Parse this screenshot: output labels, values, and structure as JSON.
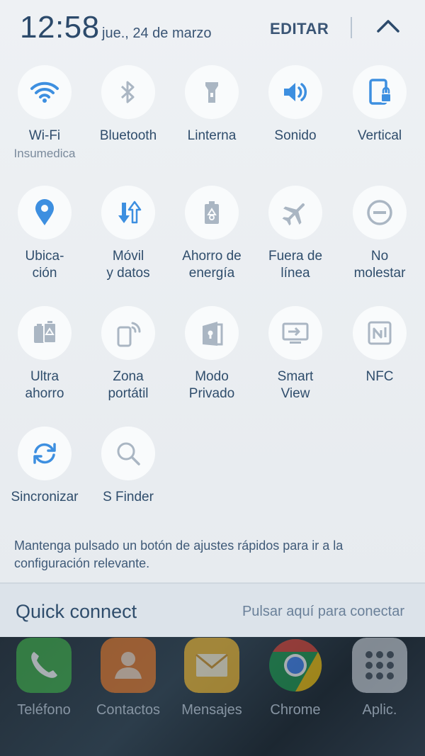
{
  "header": {
    "time": "12:58",
    "date": "jue., 24 de marzo",
    "edit_label": "EDITAR"
  },
  "tiles": [
    {
      "label": "Wi-Fi",
      "sub": "Insumedica",
      "icon": "wifi-icon"
    },
    {
      "label": "Bluetooth",
      "icon": "bluetooth-icon"
    },
    {
      "label": "Linterna",
      "icon": "flashlight-icon"
    },
    {
      "label": "Sonido",
      "icon": "sound-icon"
    },
    {
      "label": "Vertical",
      "icon": "rotation-lock-icon"
    },
    {
      "label": "Ubica-\nción",
      "icon": "location-icon"
    },
    {
      "label": "Móvil\ny datos",
      "icon": "mobile-data-icon"
    },
    {
      "label": "Ahorro de\nenergía",
      "icon": "power-saving-icon"
    },
    {
      "label": "Fuera de\nlínea",
      "icon": "airplane-icon"
    },
    {
      "label": "No\nmolestar",
      "icon": "do-not-disturb-icon"
    },
    {
      "label": "Ultra\nahorro",
      "icon": "ultra-power-saving-icon"
    },
    {
      "label": "Zona\nportátil",
      "icon": "hotspot-icon"
    },
    {
      "label": "Modo\nPrivado",
      "icon": "private-mode-icon"
    },
    {
      "label": "Smart\nView",
      "icon": "smart-view-icon"
    },
    {
      "label": "NFC",
      "icon": "nfc-icon"
    },
    {
      "label": "Sincronizar",
      "icon": "sync-icon"
    },
    {
      "label": "S Finder",
      "icon": "search-icon"
    }
  ],
  "hint": "Mantenga pulsado un botón de ajustes rápidos para ir a la configuración relevante.",
  "quick_connect": {
    "title": "Quick connect",
    "action": "Pulsar aquí para conectar"
  },
  "dock": [
    {
      "label": "Teléfono",
      "icon": "phone-icon"
    },
    {
      "label": "Contactos",
      "icon": "contacts-icon"
    },
    {
      "label": "Mensajes",
      "icon": "messages-icon"
    },
    {
      "label": "Chrome",
      "icon": "chrome-icon"
    },
    {
      "label": "Aplic.",
      "icon": "apps-icon"
    }
  ],
  "colors": {
    "active_blue": "#3d8fe0",
    "inactive_grey": "#aab6c3",
    "text_dark": "#2f4d6c"
  }
}
